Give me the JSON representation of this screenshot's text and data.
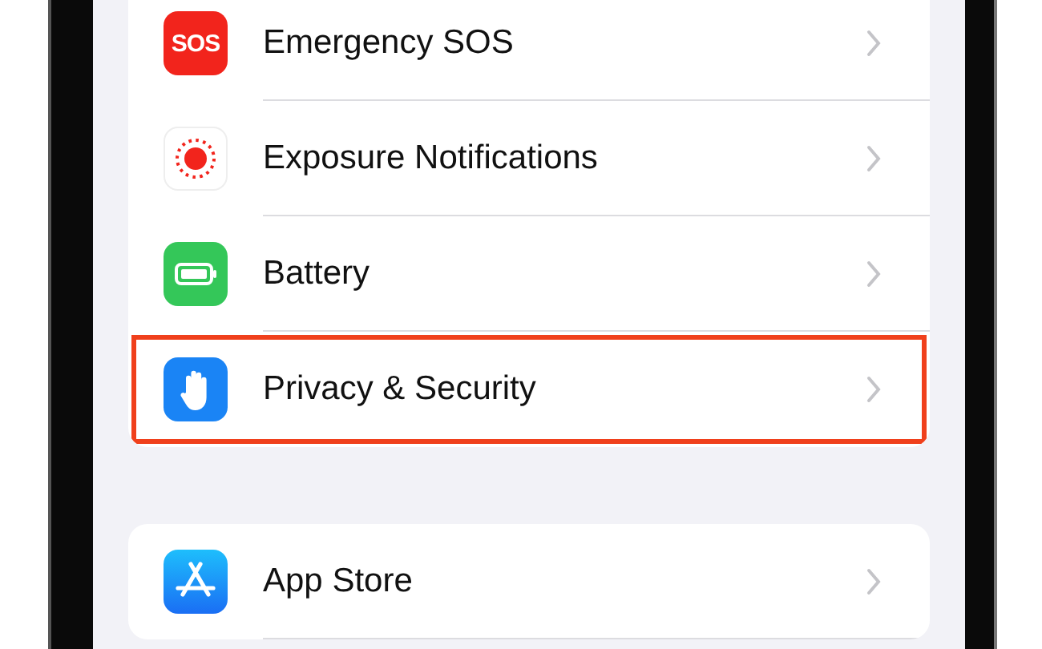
{
  "groups": [
    {
      "items": [
        {
          "label": "Emergency SOS",
          "kind": "sos",
          "icon_text": "SOS",
          "highlighted": false
        },
        {
          "label": "Exposure Notifications",
          "kind": "exposure",
          "highlighted": false
        },
        {
          "label": "Battery",
          "kind": "battery",
          "highlighted": false
        },
        {
          "label": "Privacy & Security",
          "kind": "privacy",
          "highlighted": true
        }
      ]
    },
    {
      "items": [
        {
          "label": "App Store",
          "kind": "app-store",
          "highlighted": false
        }
      ]
    }
  ]
}
